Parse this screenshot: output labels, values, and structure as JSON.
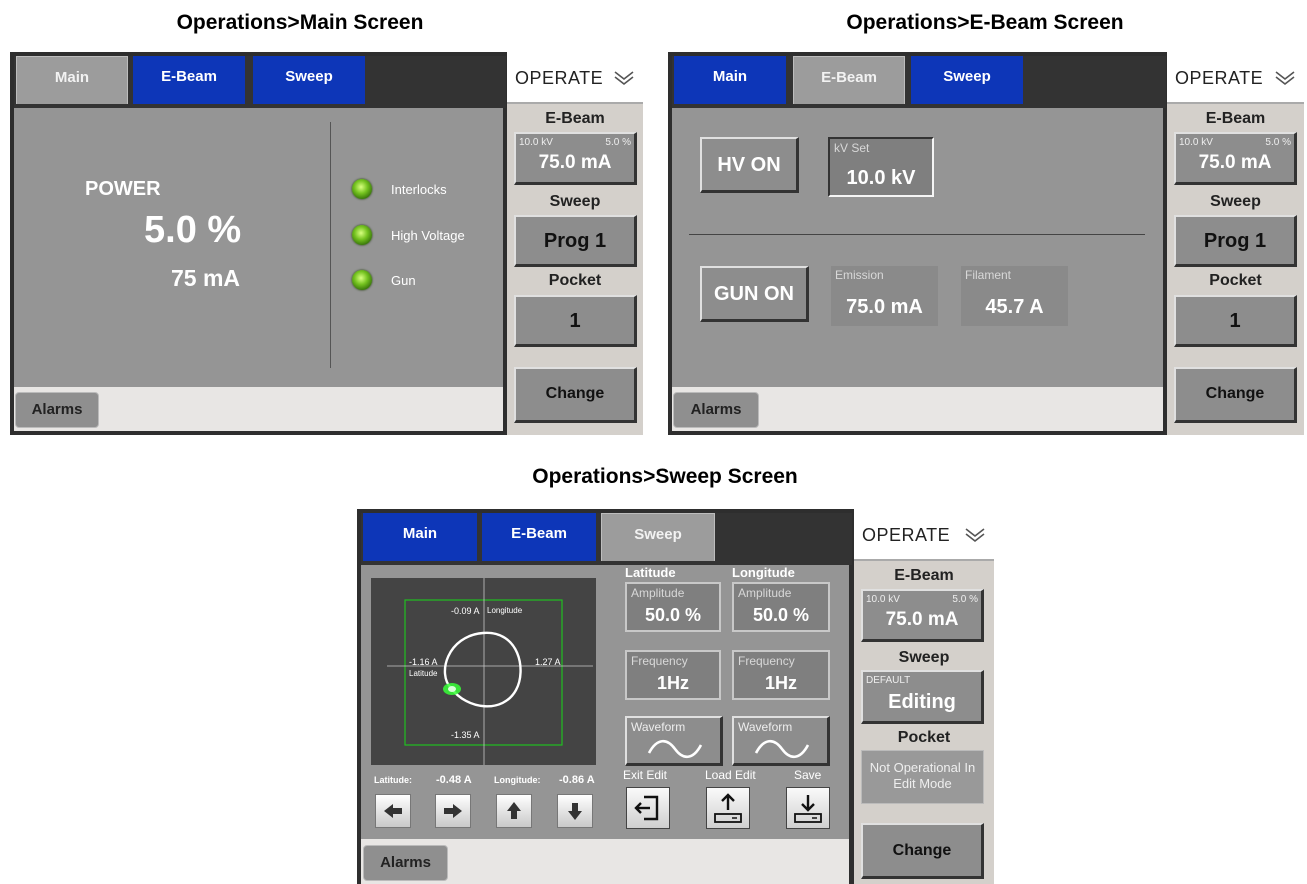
{
  "captions": {
    "main": "Operations>Main Screen",
    "ebeam": "Operations>E-Beam Screen",
    "sweep": "Operations>Sweep Screen"
  },
  "tabs": {
    "main": "Main",
    "ebeam": "E-Beam",
    "sweep": "Sweep"
  },
  "alarms_label": "Alarms",
  "sidebar": {
    "operate_label": "OPERATE",
    "ebeam_label": "E-Beam",
    "kv": "10.0 kV",
    "percent": "5.0 %",
    "emission": "75.0 mA",
    "sweep_label": "Sweep",
    "sweep_value": "Prog 1",
    "pocket_label": "Pocket",
    "pocket_value": "1",
    "change_label": "Change"
  },
  "main_screen": {
    "power_label": "POWER",
    "power_percent": "5.0 %",
    "power_current": "75 mA",
    "indicators": [
      "Interlocks",
      "High Voltage",
      "Gun"
    ]
  },
  "ebeam_screen": {
    "hv_button": "HV ON",
    "kv_set_label": "kV Set",
    "kv_set_value": "10.0 kV",
    "gun_button": "GUN ON",
    "emission_label": "Emission",
    "emission_value": "75.0 mA",
    "filament_label": "Filament",
    "filament_value": "45.7 A"
  },
  "sweep_screen": {
    "plot": {
      "top": "-0.09 A",
      "bottom": "-1.35 A",
      "left": "-1.16 A",
      "right": "1.27 A",
      "x_axis_label": "Latitude",
      "y_axis_label": "Longitude"
    },
    "latitude_label": "Latitude:",
    "latitude_value": "-0.48 A",
    "longitude_label": "Longitude:",
    "longitude_value": "-0.86 A",
    "latitude_header": "Latitude",
    "longitude_header": "Longitude",
    "amplitude_label": "Amplitude",
    "lat_amplitude": "50.0 %",
    "lon_amplitude": "50.0 %",
    "frequency_label": "Frequency",
    "lat_frequency": "1Hz",
    "lon_frequency": "1Hz",
    "waveform_label": "Waveform",
    "exit_edit": "Exit Edit",
    "load_edit": "Load Edit",
    "save": "Save",
    "sidebar_sweep_default": "DEFAULT",
    "sidebar_sweep_value": "Editing",
    "pocket_note": "Not Operational In Edit Mode"
  }
}
